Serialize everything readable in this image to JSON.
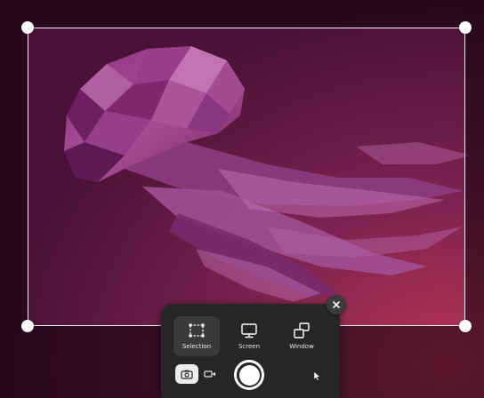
{
  "screenshot_ui": {
    "close_icon": "close-icon",
    "modes": [
      {
        "label": "Selection",
        "icon": "selection-icon",
        "active": true
      },
      {
        "label": "Screen",
        "icon": "monitor-icon",
        "active": false
      },
      {
        "label": "Window",
        "icon": "window-icon",
        "active": false
      }
    ],
    "capture_type": {
      "screenshot_icon": "screenshot-icon",
      "screenshot_selected": true,
      "screencast_icon": "video-camera-icon"
    },
    "capture_button_icon": "capture-button",
    "show_pointer_icon": "pointer-icon"
  },
  "colors": {
    "wallpaper_dark": "#3a0e2a",
    "wallpaper_mid": "#7a1f4f",
    "jellyfish": "#9a3f8c",
    "panel_bg": "#262626",
    "active_mode_bg": "#3a3a3a"
  }
}
